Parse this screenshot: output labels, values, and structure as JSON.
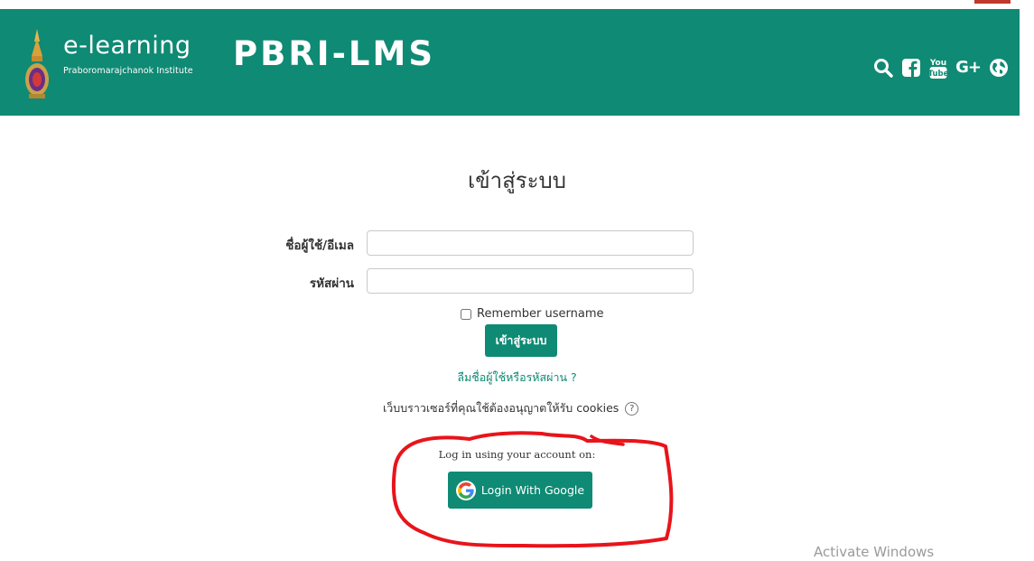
{
  "header": {
    "brand_title": "e-learning",
    "brand_subtitle": "Praboromarajchanok Institute",
    "site_name": "PBRI-LMS",
    "background_color": "#0f8a74",
    "icons": [
      "search-icon",
      "facebook-icon",
      "youtube-icon",
      "google-plus-icon",
      "globe-icon"
    ],
    "youtube_top": "You",
    "youtube_bottom": "Tube",
    "gplus_label": "G+"
  },
  "login": {
    "title": "เข้าสู่ระบบ",
    "username_label": "ชื่อผู้ใช้/อีเมล",
    "username_value": "",
    "password_label": "รหัสผ่าน",
    "password_value": "",
    "remember_label": "Remember username",
    "remember_checked": false,
    "submit_label": "เข้าสู่ระบบ",
    "forgot_link": "ลืมชื่อผู้ใช้หรือรหัสผ่าน ?",
    "cookies_notice": "เว็บบราวเซอร์ที่คุณใช้ต้องอนุญาตให้รับ cookies",
    "help_glyph": "?"
  },
  "oauth": {
    "label": "Log in using your account on:",
    "google_button_label": "Login With Google",
    "google_letter": "G"
  },
  "overlay": {
    "watermark": "Activate Windows",
    "annotation_color": "#e8141b"
  }
}
